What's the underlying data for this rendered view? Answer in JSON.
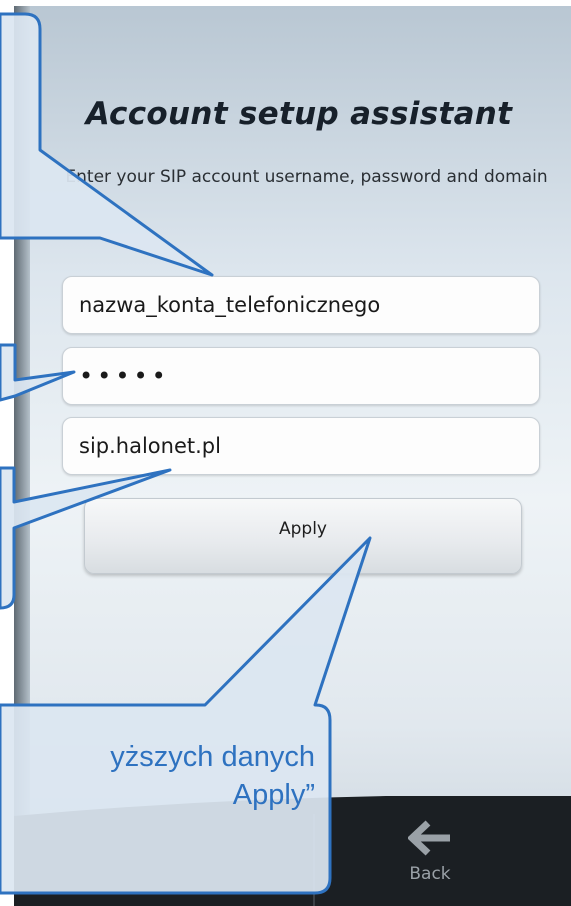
{
  "screen": {
    "title": "Account setup assistant",
    "subtitle": "Enter your SIP account username, password and domain"
  },
  "form": {
    "username_value": "nazwa_konta_telefonicznego",
    "password_value": "•••••",
    "domain_value": "sip.halonet.pl",
    "apply_label": "Apply"
  },
  "nav": {
    "back_label": "Back",
    "back_icon": "arrow-left-icon"
  },
  "callout": {
    "line1": "yższych danych",
    "line2": "Apply”"
  },
  "colors": {
    "callout_fill": "#dbe6f1",
    "callout_border": "#2e72c0",
    "nav_bar": "#1b1f23"
  }
}
